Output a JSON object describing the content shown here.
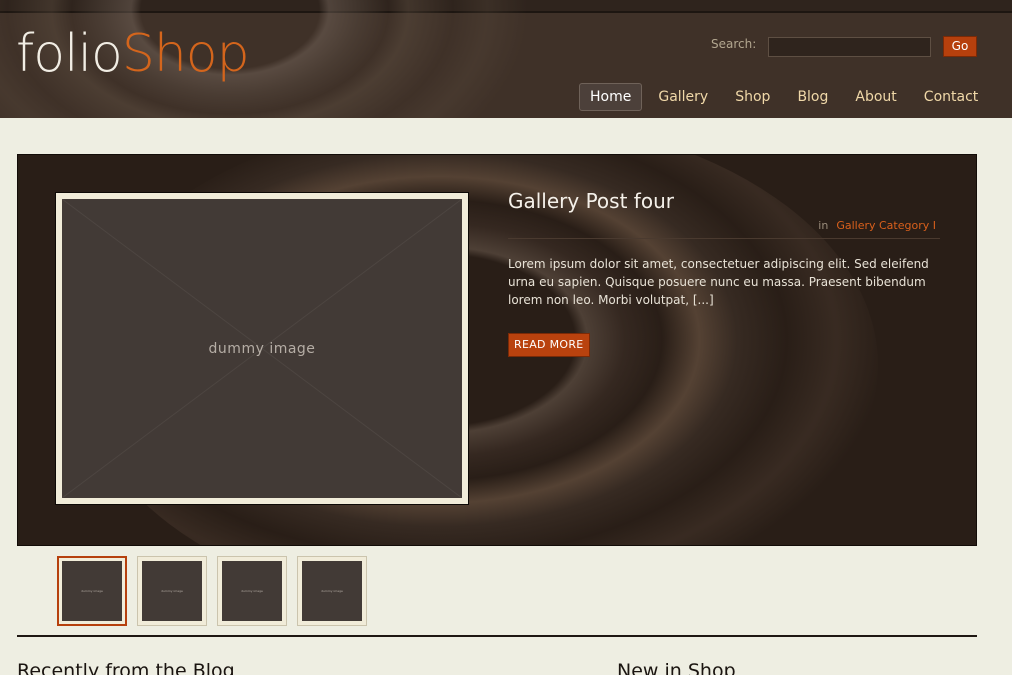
{
  "brand": {
    "part1": "folio",
    "part2": "Shop"
  },
  "search": {
    "label": "Search:",
    "value": "",
    "button": "Go"
  },
  "nav": {
    "items": [
      {
        "label": "Home",
        "active": true
      },
      {
        "label": "Gallery",
        "active": false
      },
      {
        "label": "Shop",
        "active": false
      },
      {
        "label": "Blog",
        "active": false
      },
      {
        "label": "About",
        "active": false
      },
      {
        "label": "Contact",
        "active": false
      }
    ]
  },
  "feature": {
    "image_text": "dummy image",
    "title": "Gallery Post four",
    "meta_in": "in",
    "category": "Gallery Category I",
    "excerpt": "Lorem ipsum dolor sit amet, consectetuer adipiscing elit. Sed eleifend urna eu sapien. Quisque posuere nunc eu massa. Praesent bibendum lorem non leo. Morbi volutpat, [...]",
    "read_more": "READ MORE"
  },
  "thumbs": [
    {
      "label": "dummy image",
      "active": true
    },
    {
      "label": "dummy image",
      "active": false
    },
    {
      "label": "dummy image",
      "active": false
    },
    {
      "label": "dummy image",
      "active": false
    }
  ],
  "sections": {
    "blog_heading": "Recently from the Blog",
    "shop_heading": "New in Shop"
  },
  "colors": {
    "accent": "#b6400d",
    "header_bg": "#3f3128",
    "page_bg": "#eeeee2"
  }
}
